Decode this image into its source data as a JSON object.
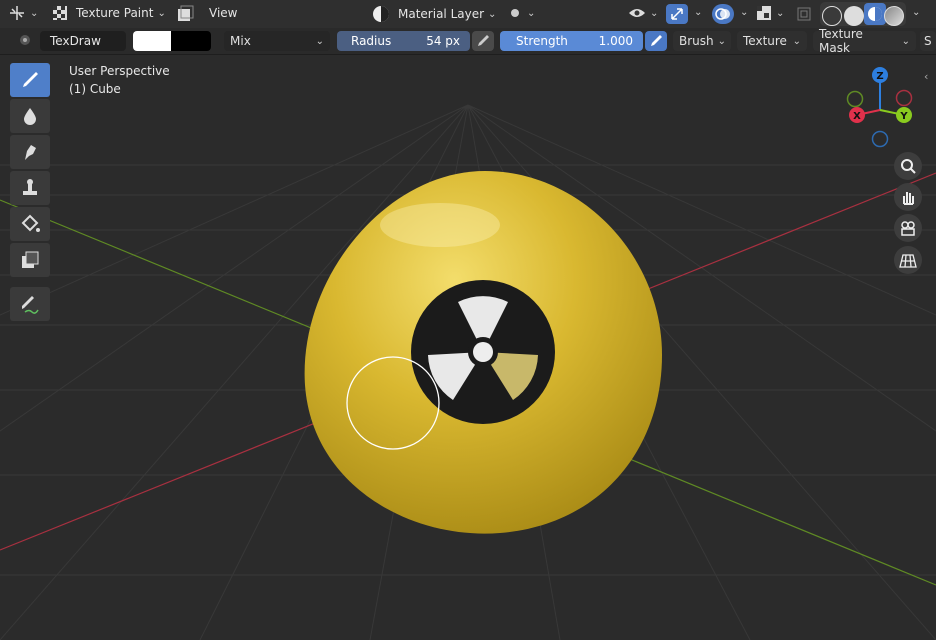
{
  "header": {
    "editor_type_icon": "transform-editor-icon",
    "mode_label": "Texture Paint",
    "menu_view": "View",
    "layer_label": "Material Layer",
    "icons": [
      "checkerboard-icon",
      "paint-mode-icon",
      "material-layer-icon",
      "dot-icon",
      "eye-icon",
      "gizmo-icon",
      "overlay-icon",
      "xray-icon"
    ]
  },
  "toolbar": {
    "brush_name": "TexDraw",
    "primary_color": "#ffffff",
    "secondary_color": "#000000",
    "blend_mode": "Mix",
    "radius_label": "Radius",
    "radius_value": "54 px",
    "strength_label": "Strength",
    "strength_value": "1.000",
    "brush_menu": "Brush",
    "texture_menu": "Texture",
    "texture_mask_menu": "Texture Mask",
    "truncated_menu": "S"
  },
  "viewport": {
    "view_name": "User Perspective",
    "object_name": "(1) Cube",
    "gizmo_axes": {
      "z": "Z",
      "x": "X",
      "y": "Y"
    },
    "colors": {
      "x_axis": "#e0314b",
      "y_axis": "#8acb1f",
      "z_axis": "#2d7fe0",
      "sphere": "#d8b830",
      "brush_circle": "#ffffff"
    }
  },
  "tools": [
    "draw-brush-icon",
    "soften-icon",
    "smear-icon",
    "clone-icon",
    "fill-icon",
    "mask-icon",
    "annotate-icon"
  ],
  "nav": [
    "zoom-icon",
    "hand-pan-icon",
    "camera-icon",
    "grid-ortho-icon"
  ]
}
